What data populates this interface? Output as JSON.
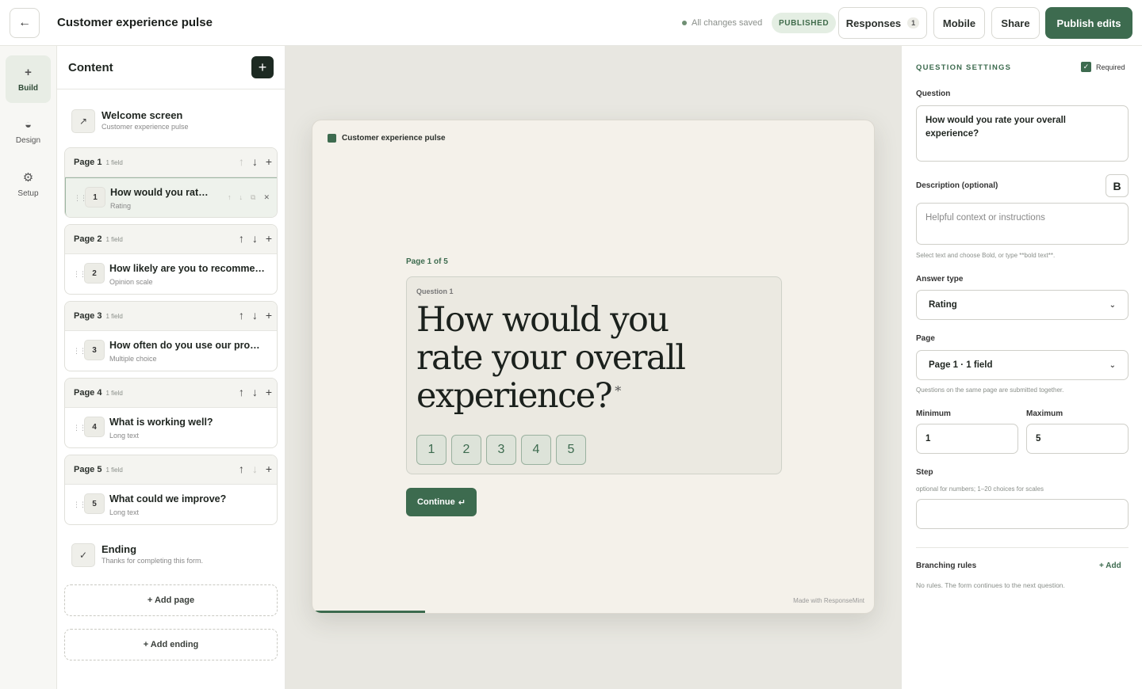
{
  "header": {
    "back_icon": "arrow-left-icon",
    "title": "Customer experience pulse",
    "saved_status": "All changes saved",
    "status_badge": "PUBLISHED",
    "responses_label": "Responses",
    "responses_count": "1",
    "mobile_label": "Mobile",
    "share_label": "Share",
    "publish_label": "Publish edits"
  },
  "rail": {
    "items": [
      {
        "label": "Build",
        "icon": "+"
      },
      {
        "label": "Design",
        "icon": "◒"
      },
      {
        "label": "Setup",
        "icon": "⚙"
      }
    ]
  },
  "content": {
    "title": "Content",
    "add_icon": "+",
    "welcome": {
      "title": "Welcome screen",
      "subtitle": "Customer experience pulse",
      "icon": "↗"
    },
    "pages": [
      {
        "title": "Page 1",
        "count": "1 field",
        "q_num": "1",
        "q_title": "How would you rate your overall experience?",
        "q_type": "Rating"
      },
      {
        "title": "Page 2",
        "count": "1 field",
        "q_num": "2",
        "q_title": "How likely are you to recommend us?",
        "q_type": "Opinion scale"
      },
      {
        "title": "Page 3",
        "count": "1 field",
        "q_num": "3",
        "q_title": "How often do you use our product?",
        "q_type": "Multiple choice"
      },
      {
        "title": "Page 4",
        "count": "1 field",
        "q_num": "4",
        "q_title": "What is working well?",
        "q_type": "Long text"
      },
      {
        "title": "Page 5",
        "count": "1 field",
        "q_num": "5",
        "q_title": "What could we improve?",
        "q_type": "Long text"
      }
    ],
    "ending": {
      "title": "Ending",
      "subtitle": "Thanks for completing this form.",
      "icon": "✓"
    },
    "add_page": "+ Add page",
    "add_ending": "+ Add ending"
  },
  "preview": {
    "brand": "Customer experience pulse",
    "page_indicator": "Page 1 of 5",
    "question_label": "Question 1",
    "question_text": "How would you rate your overall experience?",
    "required_mark": "*",
    "ratings": [
      "1",
      "2",
      "3",
      "4",
      "5"
    ],
    "continue_label": "Continue",
    "continue_icon": "↵",
    "footer": "Made with ResponseMint",
    "progress": 0.2
  },
  "settings": {
    "title": "QUESTION SETTINGS",
    "required_label": "Required",
    "required_checked": true,
    "question_label": "Question",
    "question_value": "How would you rate your overall experience?",
    "description_label": "Description (optional)",
    "bold_label": "B",
    "description_placeholder": "Helpful context or instructions",
    "description_hint": "Select text and choose Bold, or type **bold text**.",
    "answer_type_label": "Answer type",
    "answer_type_value": "Rating",
    "page_label": "Page",
    "page_value": "Page 1 · 1 field",
    "page_hint": "Questions on the same page are submitted together.",
    "minimum_label": "Minimum",
    "minimum_value": "1",
    "maximum_label": "Maximum",
    "maximum_value": "5",
    "step_label": "Step",
    "step_hint": "optional for numbers; 1–20 choices for scales",
    "step_value": "",
    "branching_label": "Branching rules",
    "branching_add": "+ Add",
    "branching_hint": "No rules. The form continues to the next question."
  },
  "colors": {
    "accent": "#3d6b4f",
    "canvas_bg": "#e8e7e1",
    "preview_bg": "#f4f1ea"
  }
}
